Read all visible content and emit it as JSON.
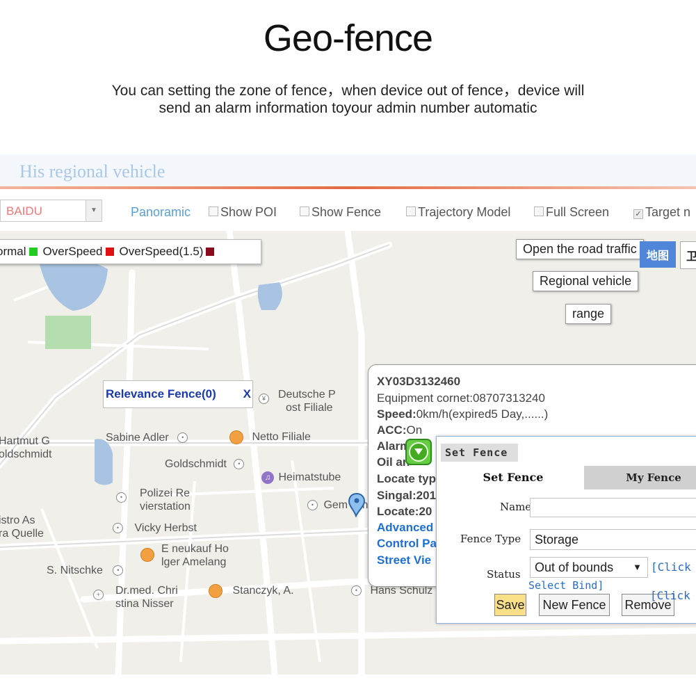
{
  "heading": {
    "title": "Geo-fence",
    "line1": "You can setting the zone of fence，when device out of fence，device will",
    "line2": "send an alarm information toyour admin number automatic"
  },
  "app": {
    "header_title": "His regional vehicle",
    "map_source": "BAIDU",
    "toolbar": {
      "panoramic": "Panoramic",
      "show_poi": "Show POI",
      "show_fence": "Show Fence",
      "trajectory_model": "Trajectory Model",
      "full_screen": "Full Screen",
      "target": "Target n"
    },
    "legend": {
      "normal": "ormal",
      "overspeed": "OverSpeed",
      "overspeed15": "OverSpeed(1.5)",
      "colors": {
        "normal": "#22cc22",
        "overspeed": "#e01010",
        "overspeed15": "#8b0a1e"
      }
    },
    "map_controls": {
      "road_traffic": "Open the road traffic",
      "map_tab": "地图",
      "map_tab2": "卫",
      "regional_vehicle": "Regional vehicle",
      "range": "range"
    },
    "relevance": {
      "label": "Relevance Fence(0)",
      "close": "X"
    },
    "pois": {
      "deutsche1": "Deutsche P",
      "deutsche2": "ost Filiale",
      "hartmut1": "Hartmut G",
      "hartmut2": "oldschmidt",
      "sabine": "Sabine Adler",
      "netto": "Netto Filiale",
      "goldschmidt": "Goldschmidt",
      "heimatstube": "Heimatstube",
      "polizei1": "Polizei Re",
      "polizei2": "vierstation",
      "gem": "Gem",
      "gmbh": "mbH",
      "bistro1": "istro As",
      "bistro2": "ra Quelle",
      "vicky": "Vicky Herbst",
      "eneu1": "E neukauf Ho",
      "eneu2": "lger Amelang",
      "nitschke": "S. Nitschke",
      "drmed1": "Dr.med. Chri",
      "drmed2": "stina Nisser",
      "stanczyk": "Stanczyk, A.",
      "hans": "Hans Schulz"
    },
    "info": {
      "device": "XY03D3132460",
      "equipment": "Equipment cornet:08707313240",
      "speed_label": "Speed:",
      "speed_value": "0km/h(expired5 Day,......)",
      "acc_label": "ACC:",
      "acc_value": "On",
      "alarm": "Alarm",
      "oil": "Oil an",
      "locate_type": "Locate typ",
      "signal": "Singal:201",
      "locate": "Locate:20",
      "advanced": "Advanced",
      "control": "Control Pa",
      "street": "Street Vie"
    },
    "set_fence": {
      "title": "Set Fence",
      "tab_set": "Set Fence",
      "tab_my": "My Fence",
      "name_label": "Name",
      "name_value": "",
      "type_label": "Fence Type",
      "type_value": "Storage",
      "status_label": "Status",
      "status_value": "Out of bounds",
      "click": "[Click",
      "select_bind": "Select Bind]",
      "save": "Save",
      "new_fence": "New Fence",
      "remove": "Remove",
      "click2": "[Click"
    }
  }
}
